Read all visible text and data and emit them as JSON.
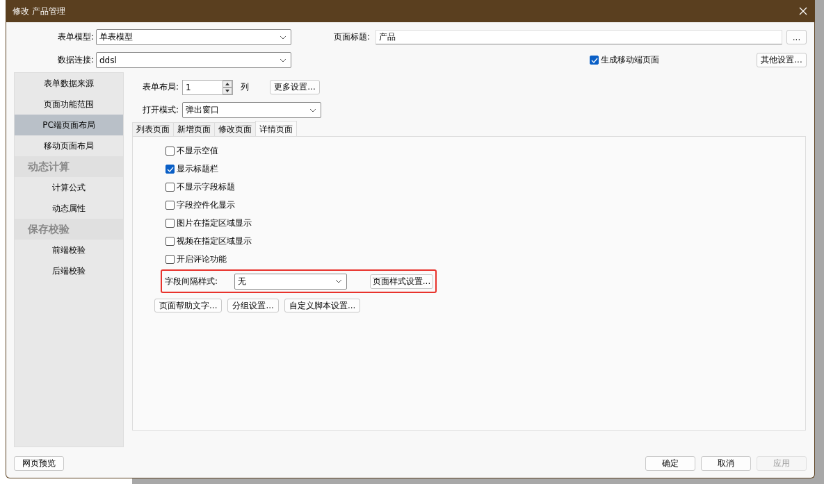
{
  "window": {
    "title": "修改 产品管理"
  },
  "form": {
    "model": {
      "label": "表单模型:",
      "value": "单表模型"
    },
    "connection": {
      "label": "数据连接:",
      "value": "ddsl"
    },
    "page_title": {
      "label": "页面标题:",
      "value": "产品",
      "button": "..."
    },
    "mobile": {
      "label": "生成移动端页面",
      "checked": true
    },
    "other_button": "其他设置..."
  },
  "sidebar": {
    "items": [
      {
        "kind": "item",
        "label": "表单数据来源",
        "selected": false
      },
      {
        "kind": "item",
        "label": "页面功能范围",
        "selected": false
      },
      {
        "kind": "item",
        "label": "PC端页面布局",
        "selected": true
      },
      {
        "kind": "item",
        "label": "移动页面布局",
        "selected": false
      },
      {
        "kind": "group",
        "label": "动态计算"
      },
      {
        "kind": "item",
        "label": "计算公式",
        "selected": false
      },
      {
        "kind": "item",
        "label": "动态属性",
        "selected": false
      },
      {
        "kind": "group",
        "label": "保存校验"
      },
      {
        "kind": "item",
        "label": "前端校验",
        "selected": false
      },
      {
        "kind": "item",
        "label": "后端校验",
        "selected": false
      }
    ]
  },
  "layout": {
    "label": "表单布局:",
    "value": "1",
    "unit": "列",
    "more_button": "更多设置..."
  },
  "open_mode": {
    "label": "打开模式:",
    "value": "弹出窗口"
  },
  "tabs": [
    {
      "label": "列表页面",
      "selected": false
    },
    {
      "label": "新增页面",
      "selected": false
    },
    {
      "label": "修改页面",
      "selected": false
    },
    {
      "label": "详情页面",
      "selected": true
    }
  ],
  "options": [
    {
      "label": "不显示空值",
      "checked": false
    },
    {
      "label": "显示标题栏",
      "checked": true
    },
    {
      "label": "不显示字段标题",
      "checked": false
    },
    {
      "label": "字段控件化显示",
      "checked": false
    },
    {
      "label": "图片在指定区域显示",
      "checked": false
    },
    {
      "label": "视频在指定区域显示",
      "checked": false
    },
    {
      "label": "开启评论功能",
      "checked": false
    }
  ],
  "spacing": {
    "label": "字段间隔样式:",
    "value": "无",
    "button": "页面样式设置...",
    "highlighted": true
  },
  "panel_buttons": [
    "页面帮助文字...",
    "分组设置...",
    "自定义脚本设置..."
  ],
  "footer": {
    "preview": {
      "label": "网页预览",
      "disabled": false
    },
    "buttons": [
      {
        "label": "确定",
        "disabled": false
      },
      {
        "label": "取消",
        "disabled": false
      },
      {
        "label": "应用",
        "disabled": true
      }
    ]
  }
}
